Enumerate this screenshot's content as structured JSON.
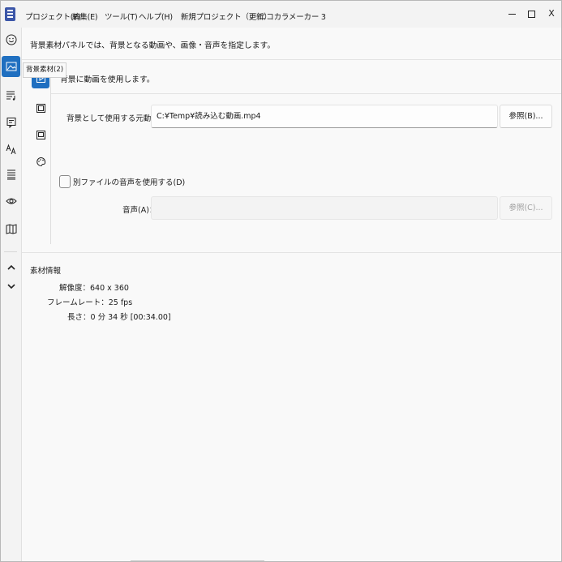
{
  "titlebar": {
    "menus": [
      "プロジェクト(P)",
      "編集(E)",
      "ツール(T)",
      "ヘルプ(H)"
    ],
    "project_name": "新規プロジェクト（更新）",
    "app_name": "ニコカラメーカー 3",
    "minimize": "",
    "maximize": "",
    "close": "X"
  },
  "left_rail": {
    "items": [
      "smiley-icon",
      "image-icon",
      "lyrics-list-icon",
      "note-icon",
      "font-icon",
      "align-icon",
      "eye-icon",
      "map-icon"
    ],
    "active_index": 1,
    "nav": [
      "chevron-up-icon",
      "chevron-down-icon"
    ]
  },
  "tooltip": "背景素材(2)",
  "description": "背景素材パネルでは、背景となる動画や、画像・音声を指定します。",
  "sub_rail": {
    "items": [
      "video-icon",
      "image-frame-icon",
      "layers-icon",
      "palette-icon"
    ],
    "active_index": 0
  },
  "mode_label": "背景に動画を使用します。",
  "video": {
    "label": "背景として使用する元動画(M)：",
    "value": "C:¥Temp¥読み込む動画.mp4",
    "browse": "参照(B)..."
  },
  "audio": {
    "checkbox_label": "別ファイルの音声を使用する(D)",
    "checked": false,
    "label": "音声(A)：",
    "value": "",
    "browse": "参照(C)..."
  },
  "info": {
    "title": "素材情報",
    "rows": [
      {
        "label": "解像度：",
        "value": "640 x 360"
      },
      {
        "label": "フレームレート：",
        "value": "25 fps"
      },
      {
        "label": "長さ：",
        "value": "0 分 34 秒  [00:34.00]"
      }
    ]
  },
  "colors": {
    "accent": "#1f6fc0",
    "background": "#f9f9f9"
  }
}
